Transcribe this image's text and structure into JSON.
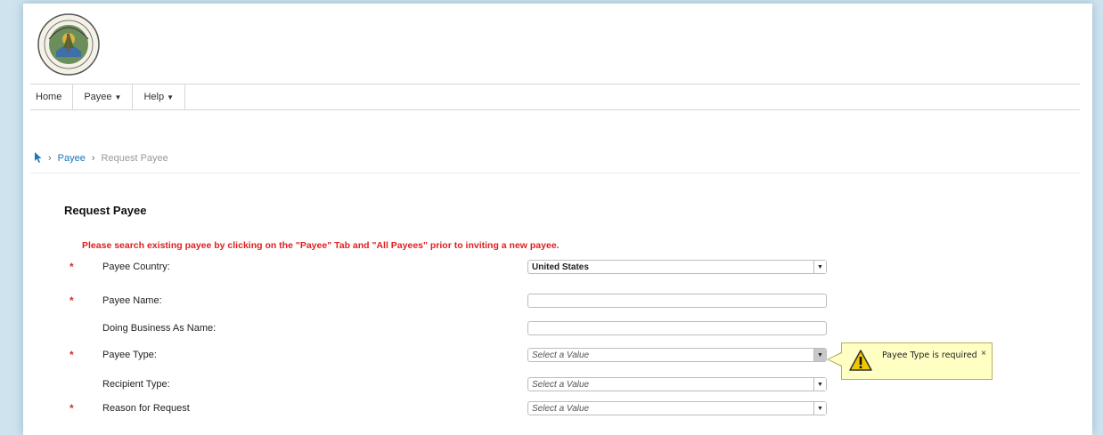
{
  "nav": {
    "items": [
      {
        "label": "Home",
        "has_caret": false
      },
      {
        "label": "Payee",
        "has_caret": true
      },
      {
        "label": "Help",
        "has_caret": true
      }
    ],
    "caret_glyph": "▼"
  },
  "breadcrumb": {
    "home_icon": "pointer-icon",
    "separator": "›",
    "items": [
      {
        "label": "Payee",
        "link": true
      },
      {
        "label": "Request Payee",
        "link": false
      }
    ]
  },
  "page": {
    "title": "Request Payee",
    "warning": "Please search existing payee by clicking on the \"Payee\" Tab and \"All Payees\" prior to inviting a new payee."
  },
  "form": {
    "required_mark": "*",
    "payee_country": {
      "label": "Payee Country:",
      "value": "United States"
    },
    "payee_name": {
      "label": "Payee Name:",
      "value": ""
    },
    "dba_name": {
      "label": "Doing Business As Name:",
      "value": ""
    },
    "payee_type": {
      "label": "Payee Type:",
      "placeholder": "Select a Value"
    },
    "recipient_type": {
      "label": "Recipient Type:",
      "placeholder": "Select a Value"
    },
    "reason_for_request": {
      "label": "Reason for Request",
      "placeholder": "Select a Value"
    }
  },
  "tooltip": {
    "message": "Payee Type is required",
    "close": "×"
  },
  "colors": {
    "warning_text": "#e01e1e",
    "link": "#1a77b8",
    "tooltip_bg": "#ffffc4",
    "required": "#c0392b"
  }
}
